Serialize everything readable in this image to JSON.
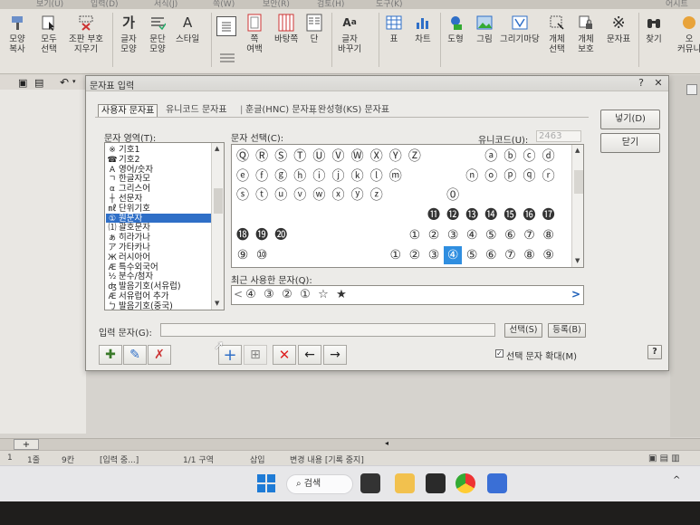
{
  "menubar": {
    "items": [
      "보기(U)",
      "입력(D)",
      "서식(J)",
      "쪽(W)",
      "보안(R)",
      "검토(H)",
      "도구(K)",
      "어시트"
    ]
  },
  "ribbon": {
    "buttons": [
      {
        "label": "모양\n복사"
      },
      {
        "label": "모두\n선택"
      },
      {
        "label": "조판 부호\n지우기"
      },
      {
        "label": "글자\n모양"
      },
      {
        "label": "문단\n모양"
      },
      {
        "label": "스타일"
      },
      {
        "label": "쪽\n여백"
      },
      {
        "label": "바탕쪽"
      },
      {
        "label": "단"
      },
      {
        "label": "글자\n바꾸기"
      },
      {
        "label": "표"
      },
      {
        "label": "차트"
      },
      {
        "label": "도형"
      },
      {
        "label": "그림"
      },
      {
        "label": "그리기마당"
      },
      {
        "label": "개체\n선택"
      },
      {
        "label": "개체\n보호"
      },
      {
        "label": "문자표"
      },
      {
        "label": "찾기"
      },
      {
        "label": "오\n커뮤니"
      }
    ]
  },
  "dialog": {
    "title": "문자표 입력",
    "help_btn": "?",
    "close_btn": "✕",
    "tabs": [
      "사용자 문자표",
      "유니코드 문자표",
      "훈글(HNC) 문자표",
      "완성형(KS) 문자표"
    ],
    "tab_separator": "|",
    "area_label": "문자 영역(T):",
    "select_label": "문자 선택(C):",
    "unicode_label": "유니코드(U):",
    "unicode_value": "2463",
    "categories": [
      {
        "glyph": "※",
        "name": "기호1"
      },
      {
        "glyph": "☎",
        "name": "기호2"
      },
      {
        "glyph": "A",
        "name": "영어/숫자"
      },
      {
        "glyph": "ㄱ",
        "name": "한글자모"
      },
      {
        "glyph": "α",
        "name": "그리스어"
      },
      {
        "glyph": "┼",
        "name": "선문자"
      },
      {
        "glyph": "㎖",
        "name": "단위기호"
      },
      {
        "glyph": "①",
        "name": "원문자"
      },
      {
        "glyph": "⑴",
        "name": "괄호문자"
      },
      {
        "glyph": "ぁ",
        "name": "히라가나"
      },
      {
        "glyph": "ア",
        "name": "가타카나"
      },
      {
        "glyph": "Ж",
        "name": "러시아어"
      },
      {
        "glyph": "Æ",
        "name": "특수외국어"
      },
      {
        "glyph": "½",
        "name": "분수/첨자"
      },
      {
        "glyph": "ʤ",
        "name": "발음기호(서유럽)"
      },
      {
        "glyph": "Æ",
        "name": "서유럽어 추가"
      },
      {
        "glyph": "ㄅ",
        "name": "발음기호(중국)"
      }
    ],
    "selected_category": 7,
    "grid": [
      [
        "Ⓠ",
        "Ⓡ",
        "Ⓢ",
        "Ⓣ",
        "Ⓤ",
        "Ⓥ",
        "Ⓦ",
        "Ⓧ",
        "Ⓨ",
        "Ⓩ",
        "",
        "",
        "",
        "ⓐ",
        "ⓑ",
        "ⓒ",
        "ⓓ"
      ],
      [
        "ⓔ",
        "ⓕ",
        "ⓖ",
        "ⓗ",
        "ⓘ",
        "ⓙ",
        "ⓚ",
        "ⓛ",
        "ⓜ",
        "",
        "",
        "",
        "ⓝ",
        "ⓞ",
        "ⓟ",
        "ⓠ",
        "ⓡ"
      ],
      [
        "ⓢ",
        "ⓣ",
        "ⓤ",
        "ⓥ",
        "ⓦ",
        "ⓧ",
        "ⓨ",
        "ⓩ",
        "",
        "",
        "",
        "⓪",
        "",
        "",
        "",
        "",
        ""
      ],
      [
        "",
        "",
        "",
        "",
        "",
        "",
        "",
        "",
        "",
        "",
        "⓫",
        "⓬",
        "⓭",
        "⓮",
        "⓯",
        "⓰",
        "⓱"
      ],
      [
        "⓲",
        "⓳",
        "⓴",
        "",
        "",
        "",
        "",
        "",
        "",
        "①",
        "②",
        "③",
        "④",
        "⑤",
        "⑥",
        "⑦",
        "⑧"
      ],
      [
        "⑨",
        "⑩",
        "",
        "",
        "",
        "",
        "",
        "",
        "①",
        "②",
        "③",
        "④",
        "⑤",
        "⑥",
        "⑦",
        "⑧",
        "⑨"
      ]
    ],
    "selected_cell": {
      "row": 5,
      "col": 11
    },
    "recent_label": "최근 사용한 문자(Q):",
    "recent": [
      "④",
      "③",
      "②",
      "①",
      "☆",
      "★"
    ],
    "recent_prev": "<",
    "recent_next": ">",
    "input_label": "입력 문자(G):",
    "input_value": "",
    "select_btn": "선택(S)",
    "register_btn": "등록(B)",
    "insert_btn": "넣기(D)",
    "close_btn2": "닫기",
    "enlarge_label": "선택 문자 확대(M)",
    "enlarge_checked": true,
    "help2": "?"
  },
  "statusbar": {
    "items": [
      "1",
      "1줄",
      "9칸",
      "[입력 중...]",
      "1/1 구역",
      "삽입",
      "변경 내용 [기록 중지]"
    ],
    "tab_plus": "+"
  },
  "taskbar": {
    "search_label": "검색"
  }
}
